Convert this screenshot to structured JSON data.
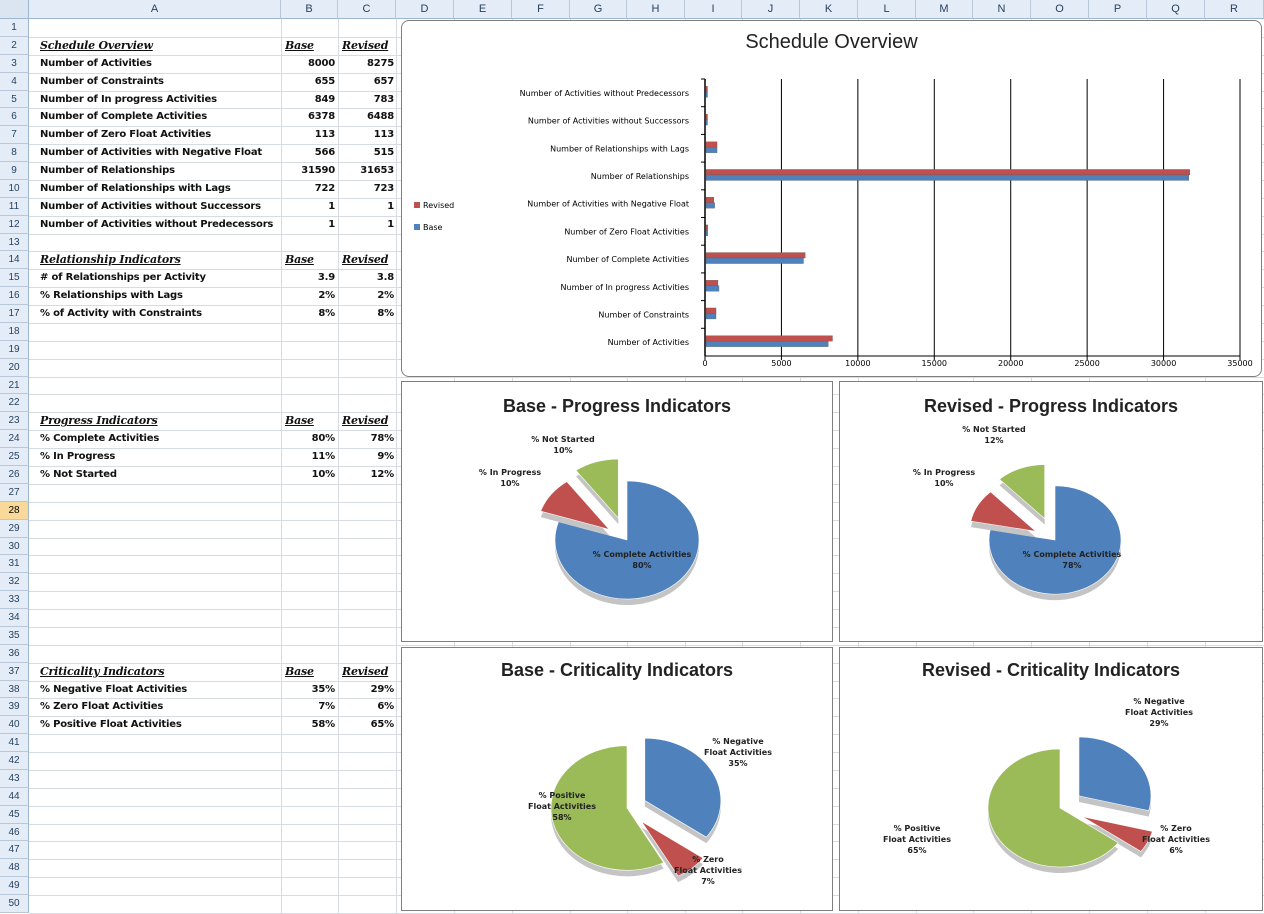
{
  "columns": [
    "A",
    "B",
    "C",
    "D",
    "E",
    "F",
    "G",
    "H",
    "I",
    "J",
    "K",
    "L",
    "M",
    "N",
    "O",
    "P",
    "Q",
    "R"
  ],
  "rows": [
    "1",
    "2",
    "3",
    "4",
    "5",
    "6",
    "7",
    "8",
    "9",
    "10",
    "11",
    "12",
    "13",
    "14",
    "15",
    "16",
    "17",
    "18",
    "19",
    "20",
    "21",
    "22",
    "23",
    "24",
    "25",
    "26",
    "27",
    "28",
    "29",
    "30",
    "31",
    "32",
    "33",
    "34",
    "35",
    "36",
    "37",
    "38",
    "39",
    "40",
    "41",
    "42",
    "43",
    "44",
    "45",
    "46",
    "47",
    "48",
    "49",
    "50"
  ],
  "selected_row": "28",
  "schedule": {
    "header": "Schedule Overview",
    "base": "Base",
    "revised": "Revised",
    "rows": [
      {
        "label": "Number of Activities",
        "base": "8000",
        "revised": "8275"
      },
      {
        "label": "Number of Constraints",
        "base": "655",
        "revised": "657"
      },
      {
        "label": "Number of In progress Activities",
        "base": "849",
        "revised": "783"
      },
      {
        "label": "Number of Complete Activities",
        "base": "6378",
        "revised": "6488"
      },
      {
        "label": "Number of Zero Float Activities",
        "base": "113",
        "revised": "113"
      },
      {
        "label": "Number of Activities with Negative Float",
        "base": "566",
        "revised": "515"
      },
      {
        "label": "Number of Relationships",
        "base": "31590",
        "revised": "31653"
      },
      {
        "label": "Number of Relationships with Lags",
        "base": "722",
        "revised": "723"
      },
      {
        "label": "Number of Activities without Successors",
        "base": "1",
        "revised": "1"
      },
      {
        "label": "Number of Activities without Predecessors",
        "base": "1",
        "revised": "1"
      }
    ]
  },
  "relationship": {
    "header": "Relationship Indicators",
    "base": "Base",
    "revised": "Revised",
    "rows": [
      {
        "label": "# of Relationships per Activity",
        "base": "3.9",
        "revised": "3.8"
      },
      {
        "label": "% Relationships with Lags",
        "base": "2%",
        "revised": "2%"
      },
      {
        "label": "% of Activity with Constraints",
        "base": "8%",
        "revised": "8%"
      }
    ]
  },
  "progress": {
    "header": "Progress Indicators",
    "base": "Base",
    "revised": "Revised",
    "rows": [
      {
        "label": "% Complete Activities",
        "base": "80%",
        "revised": "78%"
      },
      {
        "label": "% In Progress",
        "base": "11%",
        "revised": "9%"
      },
      {
        "label": "% Not Started",
        "base": "10%",
        "revised": "12%"
      }
    ]
  },
  "criticality": {
    "header": "Criticality Indicators",
    "base": "Base",
    "revised": "Revised",
    "rows": [
      {
        "label": "% Negative Float Activities",
        "base": "35%",
        "revised": "29%"
      },
      {
        "label": "% Zero Float Activities",
        "base": "7%",
        "revised": "6%"
      },
      {
        "label": "% Positive Float Activities",
        "base": "58%",
        "revised": "65%"
      }
    ]
  },
  "colors": {
    "base": "#4f81bd",
    "revised": "#c0504d",
    "green": "#9bbb59",
    "grid": "#000000"
  },
  "chart_data": [
    {
      "type": "bar",
      "title": "Schedule Overview",
      "categories": [
        "Number of Activities without Predecessors",
        "Number of Activities without Successors",
        "Number of Relationships with Lags",
        "Number of Relationships",
        "Number of Activities with Negative Float",
        "Number of Zero Float Activities",
        "Number of Complete Activities",
        "Number of In progress Activities",
        "Number of Constraints",
        "Number of Activities"
      ],
      "series": [
        {
          "name": "Revised",
          "values": [
            1,
            1,
            723,
            31653,
            515,
            113,
            6488,
            783,
            657,
            8275
          ]
        },
        {
          "name": "Base",
          "values": [
            1,
            1,
            722,
            31590,
            566,
            113,
            6378,
            849,
            655,
            8000
          ]
        }
      ],
      "xticks": [
        "0",
        "5000",
        "10000",
        "15000",
        "20000",
        "25000",
        "30000",
        "35000"
      ],
      "xlim": [
        0,
        35000
      ],
      "orientation": "horizontal",
      "legend": "left",
      "grid": true
    },
    {
      "type": "pie",
      "title": "Base - Progress Indicators",
      "slices": [
        {
          "label": "% Complete Activities",
          "pct": "80%",
          "value": 80,
          "color": "#4f81bd"
        },
        {
          "label": "% In Progress",
          "pct": "10%",
          "value": 10,
          "color": "#c0504d"
        },
        {
          "label": "% Not Started",
          "pct": "10%",
          "value": 10,
          "color": "#9bbb59"
        }
      ]
    },
    {
      "type": "pie",
      "title": "Revised  - Progress Indicators",
      "slices": [
        {
          "label": "% Complete Activities",
          "pct": "78%",
          "value": 78,
          "color": "#4f81bd"
        },
        {
          "label": "% In Progress",
          "pct": "10%",
          "value": 10,
          "color": "#c0504d"
        },
        {
          "label": "% Not Started",
          "pct": "12%",
          "value": 12,
          "color": "#9bbb59"
        }
      ]
    },
    {
      "type": "pie",
      "title": "Base - Criticality Indicators",
      "slices": [
        {
          "label": "% Negative Float Activities",
          "pct": "35%",
          "value": 35,
          "color": "#4f81bd"
        },
        {
          "label": "% Zero Float Activities",
          "pct": "7%",
          "value": 7,
          "color": "#c0504d"
        },
        {
          "label": "% Positive Float Activities",
          "pct": "58%",
          "value": 58,
          "color": "#9bbb59"
        }
      ]
    },
    {
      "type": "pie",
      "title": "Revised  - Criticality Indicators",
      "slices": [
        {
          "label": "% Negative Float Activities",
          "pct": "29%",
          "value": 29,
          "color": "#4f81bd"
        },
        {
          "label": "% Zero Float Activities",
          "pct": "6%",
          "value": 6,
          "color": "#c0504d"
        },
        {
          "label": "% Positive Float Activities",
          "pct": "65%",
          "value": 65,
          "color": "#9bbb59"
        }
      ]
    }
  ]
}
